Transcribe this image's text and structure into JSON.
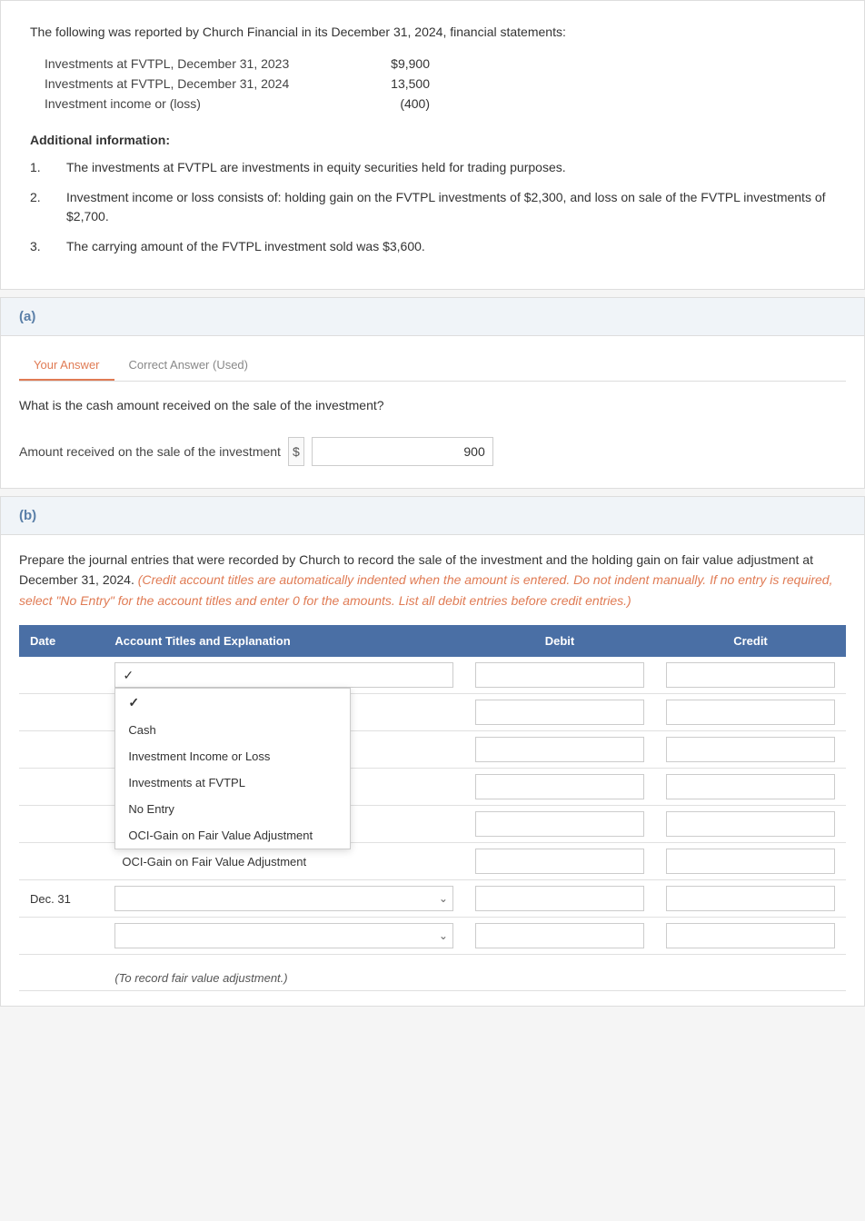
{
  "top": {
    "intro": "The following was reported by Church Financial in its December 31, 2024, financial statements:",
    "financial_rows": [
      {
        "label": "Investments at FVTPL, December 31, 2023",
        "value": "$9,900"
      },
      {
        "label": "Investments at FVTPL, December 31, 2024",
        "value": "13,500"
      },
      {
        "label": "Investment income or (loss)",
        "value": "(400)"
      }
    ],
    "additional_info_label": "Additional information:",
    "numbered_items": [
      "The investments at FVTPL are investments in equity securities held for trading purposes.",
      "Investment income or loss consists of: holding gain on the FVTPL investments of $2,300, and loss on sale of the FVTPL investments of $2,700.",
      "The carrying amount of the FVTPL investment sold was $3,600."
    ]
  },
  "section_a": {
    "header": "(a)",
    "tab_your_answer": "Your Answer",
    "tab_correct_answer": "Correct Answer (Used)",
    "question": "What is the cash amount received on the sale of the investment?",
    "input_label": "Amount received on the sale of the investment",
    "dollar_sign": "$",
    "input_value": "900"
  },
  "section_b": {
    "header": "(b)",
    "instructions": "Prepare the journal entries that were recorded by Church to record the sale of the investment and the holding gain on fair value adjustment at December 31, 2024.",
    "instructions_italic": "(Credit account titles are automatically indented when the amount is entered. Do not indent manually. If no entry is required, select \"No Entry\" for the account titles and enter 0 for the amounts. List all debit entries before credit entries.)",
    "table": {
      "headers": [
        "Date",
        "Account Titles and Explanation",
        "Debit",
        "Credit"
      ],
      "rows": [
        {
          "date": "",
          "account": "dropdown_open",
          "debit": "",
          "credit": ""
        },
        {
          "date": "",
          "account": "Cash",
          "debit": "",
          "credit": ""
        },
        {
          "date": "",
          "account": "Investment Income or Loss",
          "debit": "",
          "credit": ""
        },
        {
          "date": "",
          "account": "Investments at FVTPL",
          "debit": "",
          "credit": ""
        },
        {
          "date": "",
          "account": "No Entry",
          "debit": "",
          "credit": ""
        },
        {
          "date": "",
          "account": "OCI-Gain on Fair Value Adjustment",
          "debit": "",
          "credit": ""
        },
        {
          "date": "Dec. 31",
          "account": "dropdown_chevron",
          "debit": "",
          "credit": ""
        },
        {
          "date": "",
          "account": "dropdown_chevron_2",
          "debit": "",
          "credit": ""
        }
      ]
    },
    "footnote": "(To record fair value adjustment.)"
  }
}
